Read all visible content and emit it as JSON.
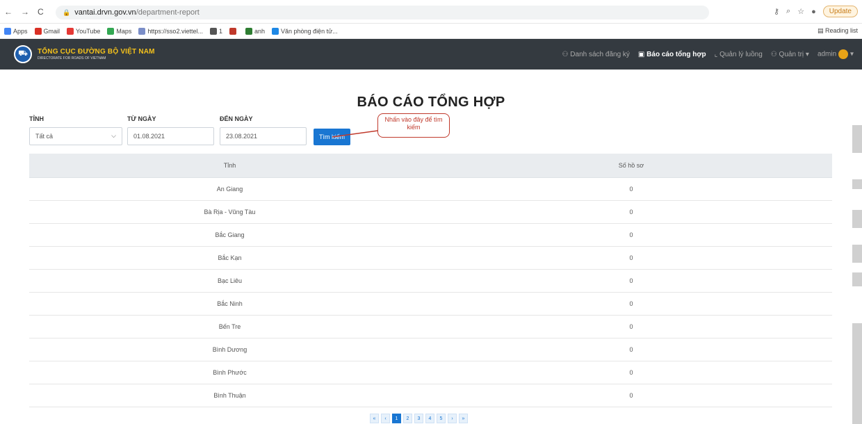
{
  "browser": {
    "url_host": "vantai.drvn.gov.vn",
    "url_path": "/department-report",
    "update_label": "Update",
    "reading_list": "Reading list"
  },
  "bookmarks": [
    {
      "label": "Apps",
      "color": "#4285f4"
    },
    {
      "label": "Gmail",
      "color": "#d93025"
    },
    {
      "label": "YouTube",
      "color": "#e53935"
    },
    {
      "label": "Maps",
      "color": "#34a853"
    },
    {
      "label": "https://sso2.viettel...",
      "color": "#7b8ec8"
    },
    {
      "label": "1",
      "color": "#555555"
    },
    {
      "label": "",
      "color": "#c0392b"
    },
    {
      "label": "anh",
      "color": "#2e7d32"
    },
    {
      "label": "Văn phòng điện tử...",
      "color": "#1e88e5"
    }
  ],
  "header": {
    "brand_name": "TỔNG CỤC ĐƯỜNG BỘ VIỆT NAM",
    "brand_sub": "DIRECTORATE FOR ROADS OF VIETNAM",
    "menu": [
      "Danh sách đăng ký",
      "Báo cáo tổng hợp",
      "Quản lý luồng",
      "Quản trị",
      "admin"
    ]
  },
  "page": {
    "title": "BÁO CÁO TỔNG HỢP",
    "filters": {
      "province_label": "TỈNH",
      "province_value": "Tất cả",
      "from_label": "TỪ NGÀY",
      "from_value": "01.08.2021",
      "to_label": "ĐẾN NGÀY",
      "to_value": "23.08.2021",
      "search_button": "Tìm kiếm"
    },
    "callout": "Nhấn vào đây để tìm kiếm"
  },
  "table": {
    "columns": [
      "Tỉnh",
      "Số hồ sơ"
    ],
    "rows": [
      [
        "An Giang",
        "0"
      ],
      [
        "Bà Rịa - Vũng Tàu",
        "0"
      ],
      [
        "Bắc Giang",
        "0"
      ],
      [
        "Bắc Kạn",
        "0"
      ],
      [
        "Bạc Liêu",
        "0"
      ],
      [
        "Bắc Ninh",
        "0"
      ],
      [
        "Bến Tre",
        "0"
      ],
      [
        "Bình Dương",
        "0"
      ],
      [
        "Bình Phước",
        "0"
      ],
      [
        "Bình Thuận",
        "0"
      ]
    ]
  },
  "pagination": [
    "«",
    "‹",
    "1",
    "2",
    "3",
    "4",
    "5",
    "›",
    "»"
  ]
}
